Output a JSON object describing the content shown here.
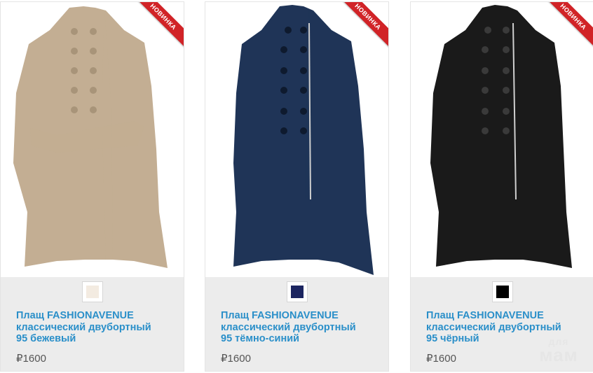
{
  "badge_label": "НОВИНКА",
  "products": [
    {
      "title_lines": [
        "Плащ FASHIONAVENUE",
        "классический двубортный",
        "95 бежевый"
      ],
      "price": "₽1600",
      "swatch_color": "#f3ebe1",
      "coat_color": "#c3ae93",
      "button_color": "#a89479"
    },
    {
      "title_lines": [
        "Плащ FASHIONAVENUE",
        "классический двубортный",
        "95 тёмно-синий"
      ],
      "price": "₽1600",
      "swatch_color": "#1c2560",
      "coat_color": "#1f3457",
      "button_color": "#0e1a2e"
    },
    {
      "title_lines": [
        "Плащ FASHIONAVENUE",
        "классический двубортный",
        "95 чёрный"
      ],
      "price": "₽1600",
      "swatch_color": "#000000",
      "coat_color": "#1a1a1a",
      "button_color": "#3a3a3a"
    }
  ],
  "watermark": {
    "top": "для",
    "bottom": "мам"
  }
}
